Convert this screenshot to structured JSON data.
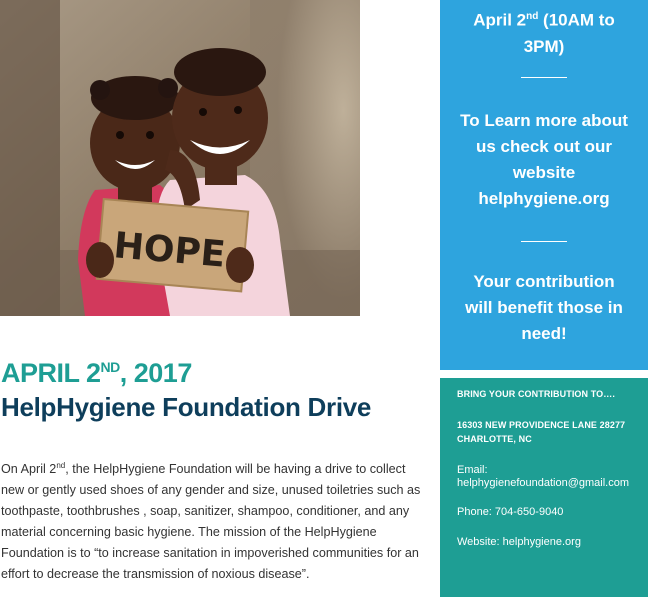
{
  "photo": {
    "sign_text": "HOPE"
  },
  "blue_box": {
    "event_time_prefix": "April 2",
    "event_time_sup": "nd",
    "event_time_suffix": " (10AM to",
    "event_time_line2": "3PM)",
    "learn_more_lines": [
      "To Learn more about",
      "us check out our",
      "website",
      "helphygiene.org"
    ],
    "contribution_lines": [
      "Your contribution",
      "will benefit those in",
      "need!"
    ]
  },
  "teal_box": {
    "bring_label": "BRING YOUR CONTRIBUTION TO….",
    "address_line1": "16303 NEW PROVIDENCE LANE 28277",
    "address_line2": "CHARLOTTE, NC",
    "email_label": "Email:",
    "email_value": "helphygienefoundation@gmail.com",
    "phone": "Phone: 704-650-9040",
    "website": "Website: helphygiene.org"
  },
  "heading": {
    "date_prefix": "APRIL 2",
    "date_sup": "ND",
    "date_suffix": ", 2017",
    "title": "HelpHygiene Foundation Drive"
  },
  "body_text": {
    "prefix": "On April 2",
    "sup": "nd",
    "rest": ", the HelpHygiene Foundation will be having a drive to collect new or gently used shoes of any gender and size, unused toiletries such as toothpaste, toothbrushes , soap, sanitizer, shampoo, conditioner, and any material concerning basic hygiene. The mission of the HelpHygiene Foundation is to “to increase sanitation in impoverished communities for an effort to decrease the transmission of noxious disease”."
  },
  "colors": {
    "blue_panel": "#2ea4de",
    "teal_panel": "#1e9e94",
    "heading_teal": "#1e9e94",
    "heading_navy": "#0e3e5b"
  }
}
